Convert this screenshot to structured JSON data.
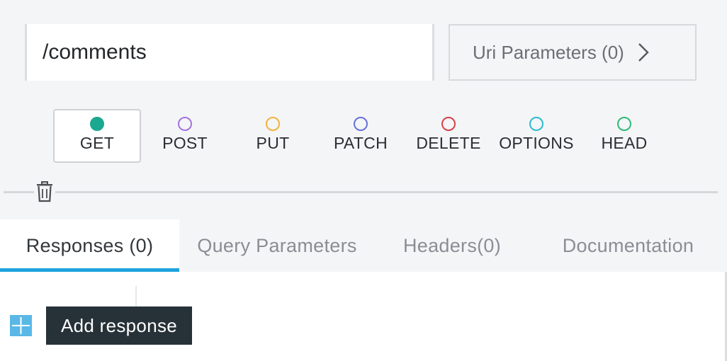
{
  "resource": {
    "path_value": "/comments",
    "uri_parameters_label": "Uri Parameters (0)"
  },
  "methods": [
    {
      "label": "GET",
      "color": "#1aa98f",
      "active": true
    },
    {
      "label": "POST",
      "color": "#a173e0",
      "active": false
    },
    {
      "label": "PUT",
      "color": "#f0b33d",
      "active": false
    },
    {
      "label": "PATCH",
      "color": "#6671d8",
      "active": false
    },
    {
      "label": "DELETE",
      "color": "#d9404b",
      "active": false
    },
    {
      "label": "OPTIONS",
      "color": "#2cbad1",
      "active": false
    },
    {
      "label": "HEAD",
      "color": "#2fba76",
      "active": false
    }
  ],
  "tabs": [
    {
      "label": "Responses (0)",
      "active": true
    },
    {
      "label": "Query Parameters",
      "active": false
    },
    {
      "label": "Headers(0)",
      "active": false
    },
    {
      "label": "Documentation",
      "active": false
    }
  ],
  "responses": {
    "add_tooltip": "Add response"
  },
  "colors": {
    "accent": "#1ea2de",
    "tooltip_bg": "#273138",
    "add_button": "#5ab8e6"
  },
  "icons": {
    "delete": "trash-icon",
    "uri_params": "chevron-right-icon",
    "add": "plus-icon"
  }
}
